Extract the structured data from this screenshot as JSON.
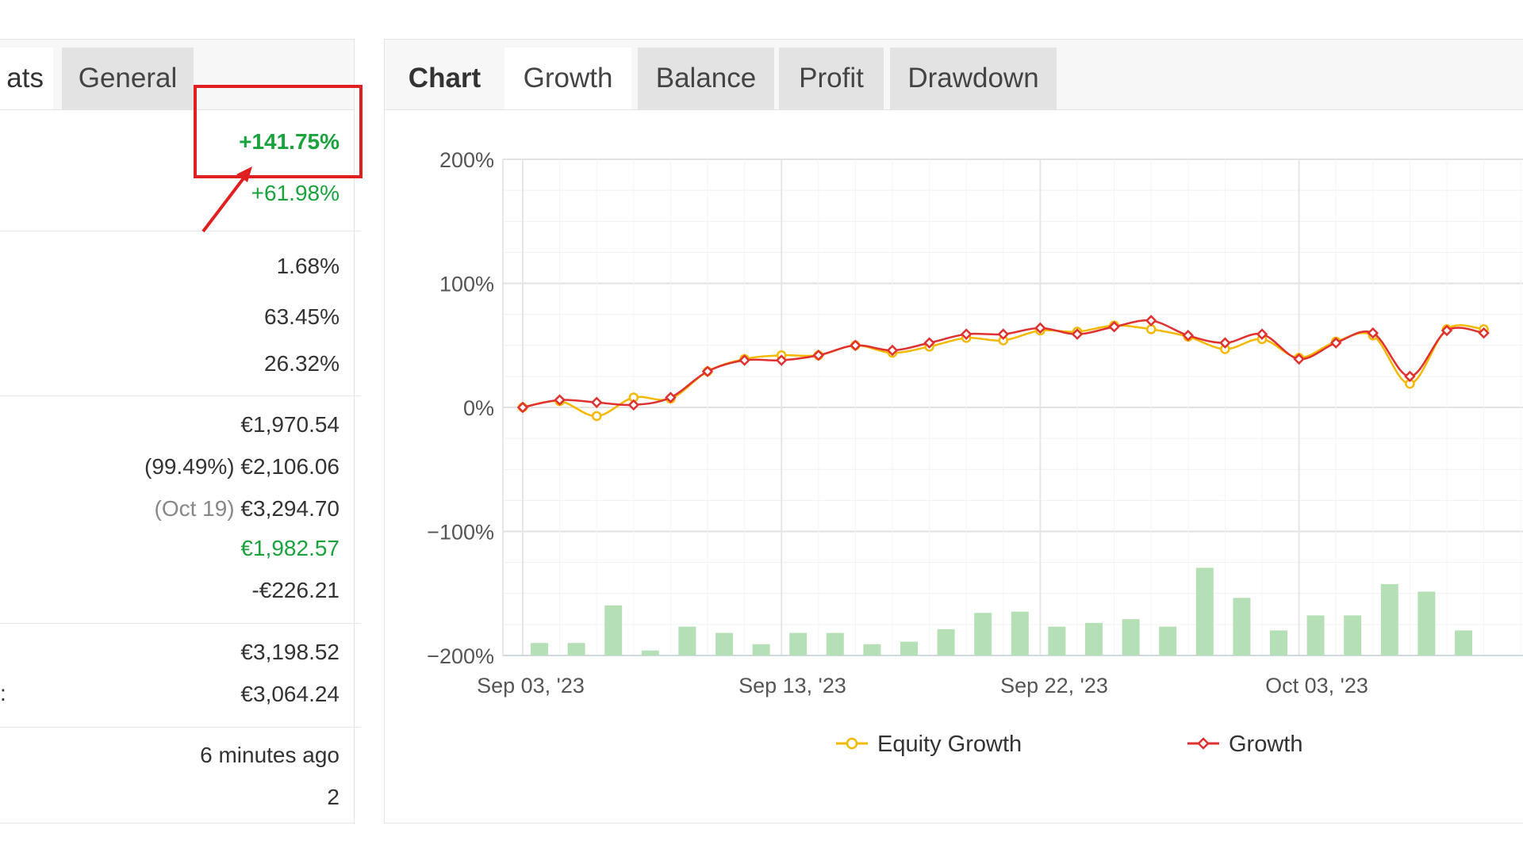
{
  "left_panel": {
    "tabs": [
      {
        "label": "ats"
      },
      {
        "label": "General"
      }
    ],
    "gain": "+141.75%",
    "abs_gain": "+61.98%",
    "daily": "1.68%",
    "monthly": "63.45%",
    "drawdown": "26.32%",
    "balance": "€1,970.54",
    "equity_pct": "(99.49%)",
    "equity": "€2,106.06",
    "highest_date": "(Oct 19)",
    "highest": "€3,294.70",
    "profit": "€1,982.57",
    "interest": "-€226.21",
    "deposits": "€3,198.52",
    "withdrawals": "€3,064.24",
    "withdrawals_edge_glyph": ":",
    "updated": "6 minutes ago",
    "tracking": "2"
  },
  "chart_panel": {
    "tabs": [
      {
        "label": "Chart"
      },
      {
        "label": "Growth"
      },
      {
        "label": "Balance"
      },
      {
        "label": "Profit"
      },
      {
        "label": "Drawdown"
      }
    ],
    "colors": {
      "equity_line": "#f5b800",
      "growth_line": "#e03030",
      "bars": "#b5e0b5",
      "highlight": "#e02020",
      "positive": "#1aa33c"
    }
  },
  "chart_data": {
    "type": "line",
    "y_ticks": [
      "200%",
      "100%",
      "0%",
      "−100%",
      "−200%"
    ],
    "y_tick_values": [
      200,
      100,
      0,
      -100,
      -200
    ],
    "ylim": [
      -200,
      200
    ],
    "x_ticks": [
      "Sep 03, '23",
      "Sep 13, '23",
      "Sep 22, '23",
      "Oct 03, '23"
    ],
    "series": [
      {
        "name": "Equity Growth",
        "values": [
          0,
          5,
          -7,
          8,
          7,
          29,
          39,
          42,
          42,
          50,
          44,
          49,
          56,
          54,
          62,
          61,
          66,
          63,
          57,
          47,
          55,
          40,
          53,
          58,
          19,
          63,
          63
        ]
      },
      {
        "name": "Growth",
        "values": [
          0,
          6,
          4,
          2,
          8,
          29,
          38,
          38,
          42,
          50,
          46,
          52,
          59,
          59,
          64,
          59,
          65,
          70,
          58,
          52,
          59,
          39,
          52,
          60,
          25,
          62,
          60
        ]
      }
    ],
    "bars": [
      10,
      10,
      40,
      4,
      23,
      18,
      9,
      18,
      18,
      9,
      11,
      21,
      34,
      35,
      23,
      26,
      29,
      23,
      70,
      46,
      20,
      32,
      32,
      57,
      51,
      20,
      0
    ],
    "legend": [
      "Equity Growth",
      "Growth"
    ]
  }
}
